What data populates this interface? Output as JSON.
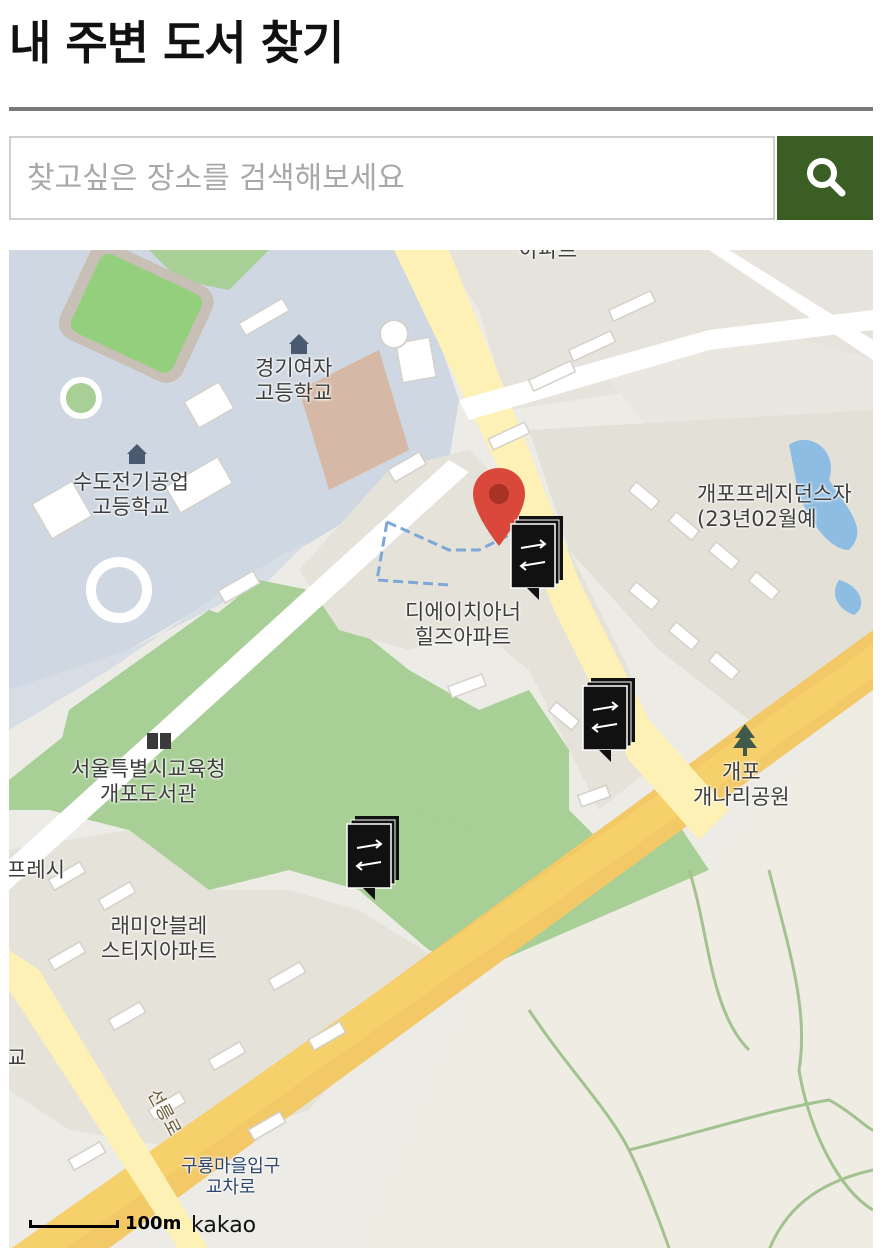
{
  "page": {
    "title": "내 주변 도서 찾기"
  },
  "search": {
    "placeholder": "찾고싶은 장소를 검색해보세요",
    "value": "",
    "button_icon": "search-icon"
  },
  "colors": {
    "search_button": "#3b5e24",
    "park_green": "#a8cf95",
    "road_yellow": "#f6d06a",
    "school_blue": "#cfd8e2",
    "pin_red": "#d9483b"
  },
  "map": {
    "labels": {
      "apt_top": "아파트",
      "girls_hs": "경기여자\n고등학교",
      "sudo_hs": "수도전기공업\n고등학교",
      "gaepo_presidence": "개포프레지던스자\n(23년02월예",
      "dh_hills": "디에이치아너\n힐즈아파트",
      "library": "서울특별시교육청\n개포도서관",
      "gaepo_park": "개포\n개나리공원",
      "presi": "프레시",
      "raemian": "래미안블레\n스티지아파트",
      "gyo": "교",
      "seolleung_ro": "선릉로",
      "guryong": "구룡마을입구\n교차로"
    },
    "markers": [
      {
        "name": "book-marker",
        "icon": "book-exchange-icon"
      },
      {
        "name": "book-marker",
        "icon": "book-exchange-icon"
      },
      {
        "name": "book-marker",
        "icon": "book-exchange-icon"
      }
    ],
    "current_location_icon": "location-pin-icon",
    "scale_label": "100m",
    "provider_logo": "kakao"
  }
}
